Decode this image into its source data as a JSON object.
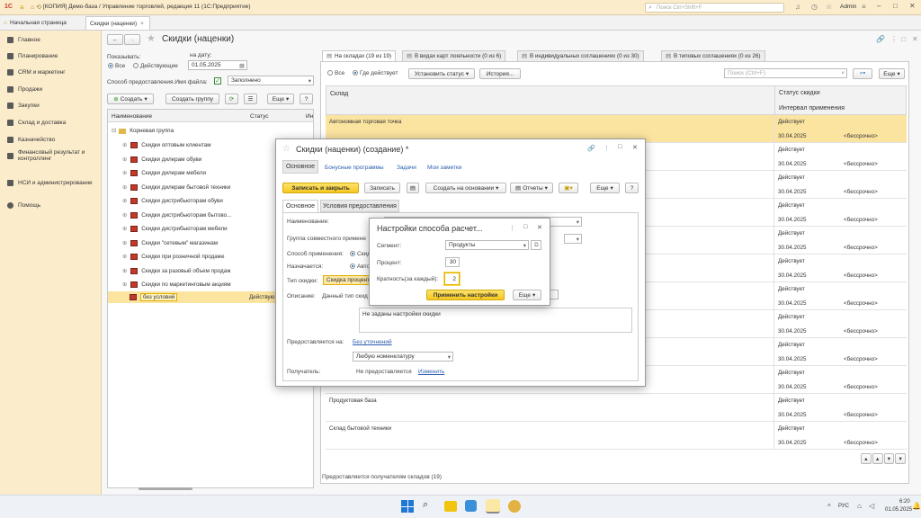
{
  "title_bar": {
    "app_name": "1С",
    "title": "[КОПИЯ] Демо-база / Управление торговлей, редакция 11  (1С:Предприятие)",
    "search_placeholder": "Поиск Ctrl+Shift+F",
    "user": "Admin"
  },
  "tabs": {
    "home": "Начальная страница",
    "discounts": "Скидки (наценки)"
  },
  "sidebar": {
    "items": [
      {
        "label": "Главное"
      },
      {
        "label": "Планирование"
      },
      {
        "label": "CRM и маркетинг"
      },
      {
        "label": "Продажи"
      },
      {
        "label": "Закупки"
      },
      {
        "label": "Склад и доставка"
      },
      {
        "label": "Казначейство"
      },
      {
        "label": "Финансовый результат и контроллинг"
      },
      {
        "label": "НСИ и администрирование"
      },
      {
        "label": "Помощь"
      }
    ]
  },
  "list_form": {
    "title": "Скидки (наценки)",
    "show_label": "Показывать:",
    "all": "Все",
    "active": "Действующие",
    "date_label": "на дату:",
    "date": "01.05.2025",
    "method_label": "Способ предоставления.Имя файла:",
    "method_value": "Заполнено",
    "create": "Создать",
    "create_group": "Создать группу",
    "more": "Еще",
    "help": "?",
    "col_name": "Наименование",
    "col_status": "Статус",
    "col_short": "Ин",
    "root": "Корневая группа",
    "items": [
      "Скидки оптовым клиентам",
      "Скидки дилерам обуви",
      "Скидки дилерам мебели",
      "Скидки дилерам бытовой техники",
      "Скидки дистрибьюторам обуви",
      "Скидки дистрибьюторам бытово...",
      "Скидки дистрибьюторам мебели",
      "Скидки \"сетевым\" магазинам",
      "Скидки при розничной продаже",
      "Скидки за разовый объем продаж",
      "Скидки по маркетинговым акциям"
    ],
    "selected": "без условий",
    "selected_status": "Действую"
  },
  "right_panel": {
    "tabs": [
      "На складах (19 из 19)",
      "В видах карт лояльности (0 из 6)",
      "В индивидуальных соглашениях (0 из 30)",
      "В типовых соглашениях (0 из 26)"
    ],
    "all": "Все",
    "active": "Где действует",
    "set_status": "Установить статус",
    "history": "История...",
    "search_placeholder": "Поиск (Ctrl+F)",
    "more": "Еще",
    "col_warehouse": "Склад",
    "col_status": "Статус скидки",
    "col_interval": "Интервал применения",
    "rows": [
      {
        "name": "Автономная торговая точка",
        "status": "Действует",
        "date": "30.04.2025",
        "until": "<бессрочно>"
      },
      {
        "name": "",
        "status": "Действует",
        "date": "30.04.2025",
        "until": "<бессрочно>"
      },
      {
        "name": "",
        "status": "Действует",
        "date": "30.04.2025",
        "until": "<бессрочно>"
      },
      {
        "name": "",
        "status": "Действует",
        "date": "30.04.2025",
        "until": "<бессрочно>"
      },
      {
        "name": "",
        "status": "Действует",
        "date": "30.04.2025",
        "until": "<бессрочно>"
      },
      {
        "name": "",
        "status": "Действует",
        "date": "30.04.2025",
        "until": "<бессрочно>"
      },
      {
        "name": "",
        "status": "Действует",
        "date": "30.04.2025",
        "until": "<бессрочно>"
      },
      {
        "name": "",
        "status": "Действует",
        "date": "30.04.2025",
        "until": "<бессрочно>"
      },
      {
        "name": "",
        "status": "Действует",
        "date": "30.04.2025",
        "until": "<бессрочно>"
      },
      {
        "name": "",
        "status": "Действует",
        "date": "30.04.2025",
        "until": "<бессрочно>"
      },
      {
        "name": "Продуктовая база",
        "status": "Действует",
        "date": "30.04.2025",
        "until": "<бессрочно>"
      },
      {
        "name": "Склад бытовой техники",
        "status": "Действует",
        "date": "30.04.2025",
        "until": "<бессрочно>"
      }
    ],
    "footer": "Предоставляется получателям складов (19)"
  },
  "create_dialog": {
    "title": "Скидки (наценки) (создание) *",
    "nav": [
      "Основное",
      "Бонусные программы",
      "Задачи",
      "Мои заметки"
    ],
    "save_close": "Записать и закрыть",
    "save": "Записать",
    "create_based": "Создать на основании",
    "reports": "Отчеты",
    "more": "Еще",
    "help": "?",
    "tab_main": "Основное",
    "tab_conditions": "Условия предоставления",
    "name_label": "Наименование:",
    "group_label": "Группа совместного примене",
    "apply_label": "Способ применения:",
    "apply_value": "Скид",
    "assign_label": "Назначается:",
    "assign_value": "Авто",
    "type_label": "Тип скидки:",
    "type_value": "Скидка процент",
    "desc_label": "Описание:",
    "desc_value": "Данный тип скид",
    "settings_text": "Не заданы настройки скидки",
    "provided_label": "Предоставляется на:",
    "provided_link": "Без уточнений",
    "nomenclature": "Любую номенклатуру",
    "recipient_label": "Получатель:",
    "recipient_value": "Не предоставляется",
    "change": "Изменить"
  },
  "settings_dialog": {
    "title": "Настройки способа расчет...",
    "segment_label": "Сегмент:",
    "segment_value": "Продукты",
    "percent_label": "Процент:",
    "percent_value": "30",
    "multiplicity_label": "Кратность(за каждый):",
    "multiplicity_value": "2",
    "apply": "Применить настройки",
    "more": "Еще"
  },
  "taskbar": {
    "lang": "РУС",
    "time": "6:20",
    "date": "01.05.2025"
  }
}
